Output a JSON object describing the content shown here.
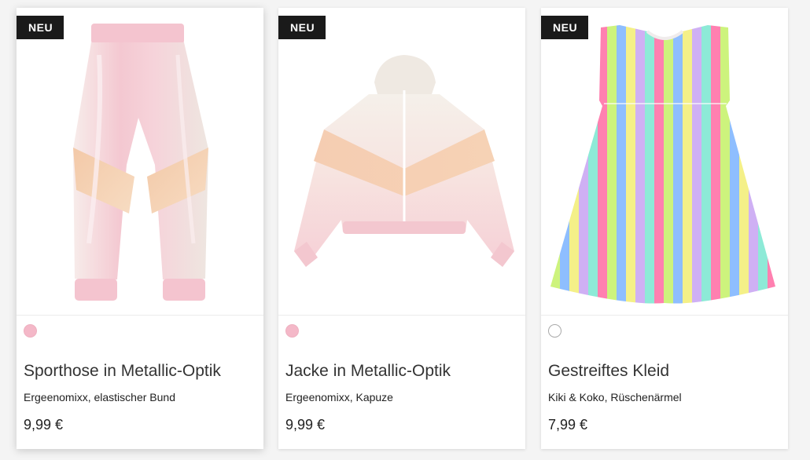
{
  "products": [
    {
      "badge": "NEU",
      "title": "Sporthose in Metallic-Optik",
      "subtitle": "Ergeenomixx, elastischer Bund",
      "price": "9,99 €",
      "swatch_color": "#f4b8c8"
    },
    {
      "badge": "NEU",
      "title": "Jacke in Metallic-Optik",
      "subtitle": "Ergeenomixx, Kapuze",
      "price": "9,99 €",
      "swatch_color": "#f4b8c8"
    },
    {
      "badge": "NEU",
      "title": "Gestreiftes Kleid",
      "subtitle": "Kiki & Koko, Rüschenärmel",
      "price": "7,99 €",
      "swatch_color": "#ffffff"
    }
  ]
}
